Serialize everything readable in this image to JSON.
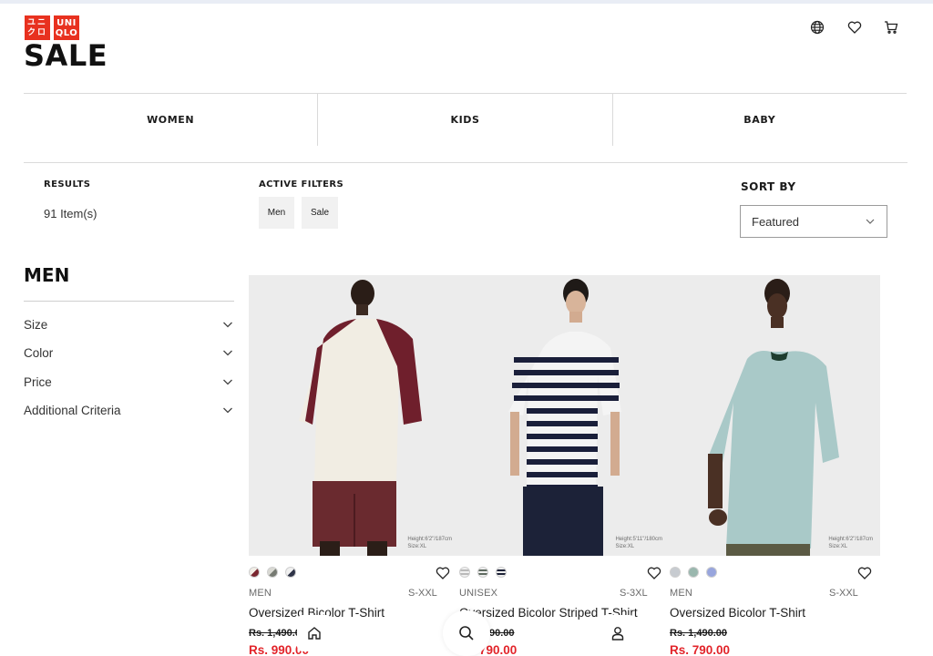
{
  "brand": {
    "logo_top": "UNI",
    "logo_top_right": "ユニ",
    "logo_bottom": "QLO",
    "logo_bottom_left": "クロ",
    "color": "#e8311f"
  },
  "page": {
    "title": "SALE"
  },
  "header_icons": [
    "globe-icon",
    "heart-icon",
    "cart-icon"
  ],
  "categories": [
    {
      "label": "WOMEN"
    },
    {
      "label": "KIDS"
    },
    {
      "label": "BABY"
    }
  ],
  "results": {
    "heading": "RESULTS",
    "count": "91 Item(s)"
  },
  "active_filters": {
    "heading": "ACTIVE FILTERS",
    "chips": [
      "Men",
      "Sale"
    ]
  },
  "sort": {
    "heading": "SORT BY",
    "selected": "Featured"
  },
  "facets": {
    "title": "MEN",
    "items": [
      "Size",
      "Color",
      "Price",
      "Additional Criteria"
    ]
  },
  "products": [
    {
      "gender": "MEN",
      "sizes": "S-XXL",
      "name": "Oversized Bicolor T-Shirt",
      "old_price": "Rs. 1,490.0",
      "new_price": "Rs. 990.00",
      "model_height": "Height:6'2\"/187cm",
      "model_size": "Size:XL",
      "swatch_colors": [
        "#7a2630",
        "#767a72",
        "#2f3448"
      ]
    },
    {
      "gender": "UNISEX",
      "sizes": "S-3XL",
      "name": "Oversized Bicolor Striped T-Shirt",
      "old_price": "90.00",
      "new_price": "790.00",
      "model_height": "Height:5'11\"/180cm",
      "model_size": "Size:XL",
      "swatch_colors": [
        "#b9b9b9",
        "#5e6a60",
        "#1e2238"
      ]
    },
    {
      "gender": "MEN",
      "sizes": "S-XXL",
      "name": "Oversized Bicolor T-Shirt",
      "old_price": "Rs. 1,490.00",
      "new_price": "Rs. 790.00",
      "model_height": "Height:6'2\"/187cm",
      "model_size": "Size:XL",
      "swatch_colors": [
        "#c7cbd0",
        "#9ab7ae",
        "#98a5dd"
      ]
    }
  ],
  "bottom_nav": [
    "home-icon",
    "search-icon",
    "account-icon"
  ],
  "colors": {
    "sale_price": "#e2242a",
    "accent": "#e8311f"
  }
}
